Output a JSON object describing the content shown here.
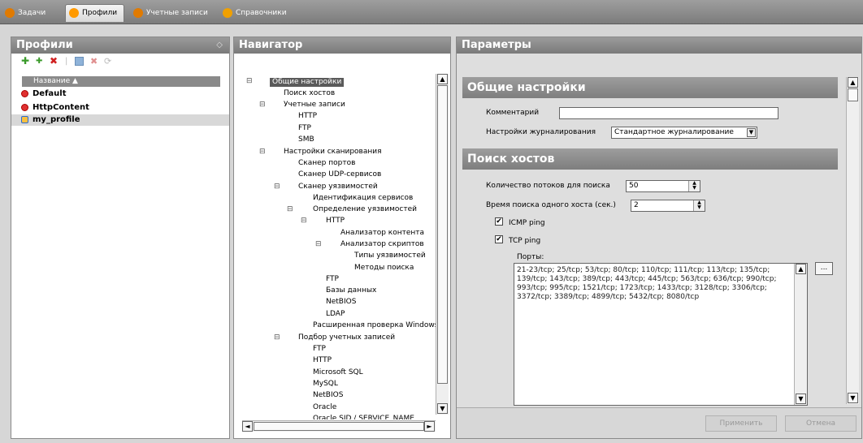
{
  "tabs": [
    {
      "label": "Задачи",
      "icon": "tasks-icon",
      "color": "#e07a00"
    },
    {
      "label": "Профили",
      "icon": "profiles-icon",
      "color": "#ff9a00"
    },
    {
      "label": "Учетные записи",
      "icon": "accounts-icon",
      "color": "#e07a00"
    },
    {
      "label": "Справочники",
      "icon": "reference-icon",
      "color": "#f0a000"
    }
  ],
  "profiles": {
    "title": "Профили",
    "column_header": "Название ▲",
    "items": [
      {
        "name": "Default"
      },
      {
        "name": "HttpContent"
      },
      {
        "name": "my_profile"
      }
    ]
  },
  "navigator": {
    "title": "Навигатор",
    "nodes": [
      "Общие настройки",
      "Поиск хостов",
      "Учетные записи",
      "HTTP",
      "FTP",
      "SMB",
      "Настройки сканирования",
      "Сканер портов",
      "Сканер UDP-сервисов",
      "Сканер уязвимостей",
      "Идентификация сервисов",
      "Определение уязвимостей",
      "HTTP",
      "Анализатор контента",
      "Анализатор скриптов",
      "Типы уязвимостей",
      "Методы поиска",
      "FTP",
      "Базы данных",
      "NetBIOS",
      "LDAP",
      "Расширенная проверка Windows",
      "Подбор учетных записей",
      "FTP",
      "HTTP",
      "Microsoft SQL",
      "MySQL",
      "NetBIOS",
      "Oracle",
      "Oracle SID / SERVICE_NAME"
    ]
  },
  "params": {
    "title": "Параметры",
    "section_general": "Общие настройки",
    "comment_label": "Комментарий",
    "comment_value": "",
    "logging_label": "Настройки журналирования",
    "logging_value": "Стандартное журналирование",
    "section_hosts": "Поиск хостов",
    "threads_label": "Количество потоков для поиска",
    "threads_value": "50",
    "timeout_label": "Время поиска одного хоста (сек.)",
    "timeout_value": "2",
    "icmp_label": "ICMP ping",
    "icmp_checked": true,
    "tcp_label": "TCP ping",
    "tcp_checked": true,
    "ports_label": "Порты:",
    "ports_value": "21-23/tcp; 25/tcp; 53/tcp; 80/tcp; 110/tcp; 111/tcp; 113/tcp; 135/tcp; 139/tcp; 143/tcp; 389/tcp; 443/tcp; 445/tcp; 563/tcp; 636/tcp; 990/tcp; 993/tcp; 995/tcp; 1521/tcp; 1723/tcp; 1433/tcp; 3128/tcp; 3306/tcp; 3372/tcp; 3389/tcp; 4899/tcp; 5432/tcp; 8080/tcp",
    "ports_more": "...",
    "apply_label": "Применить",
    "cancel_label": "Отмена"
  }
}
